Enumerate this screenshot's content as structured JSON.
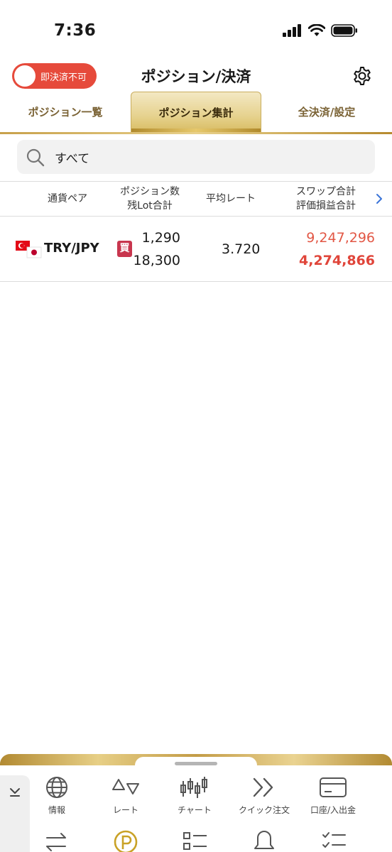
{
  "status_bar": {
    "time": "7:36"
  },
  "header": {
    "toggle_label": "即決済不可",
    "title": "ポジション/決済"
  },
  "tabs": [
    {
      "label": "ポジション一覧",
      "active": false
    },
    {
      "label": "ポジション集計",
      "active": true
    },
    {
      "label": "全決済/設定",
      "active": false
    }
  ],
  "search": {
    "value": "すべて"
  },
  "table": {
    "headers": {
      "pair": "通貨ペア",
      "count_line1": "ポジション数",
      "count_line2": "残Lot合計",
      "rate": "平均レート",
      "swap_line1": "スワップ合計",
      "swap_line2": "評価損益合計"
    },
    "rows": [
      {
        "pair": "TRY/JPY",
        "side": "買",
        "positions": "1,290",
        "lots": "18,300",
        "avg_rate": "3.720",
        "swap_total": "9,247,296",
        "pl_total": "4,274,866"
      }
    ]
  },
  "bottom_menu": {
    "items": [
      {
        "label": "情報",
        "icon": "globe-icon"
      },
      {
        "label": "レート",
        "icon": "rate-triangles-icon"
      },
      {
        "label": "チャート",
        "icon": "candlestick-icon"
      },
      {
        "label": "クイック注文",
        "icon": "double-chevron-icon"
      },
      {
        "label": "口座/入出金",
        "icon": "card-icon"
      }
    ]
  },
  "colors": {
    "toggle_bg": "#e64a3b",
    "gold": "#c7a04a",
    "profit_red": "#e0453a",
    "buy_badge": "#c8364e"
  }
}
